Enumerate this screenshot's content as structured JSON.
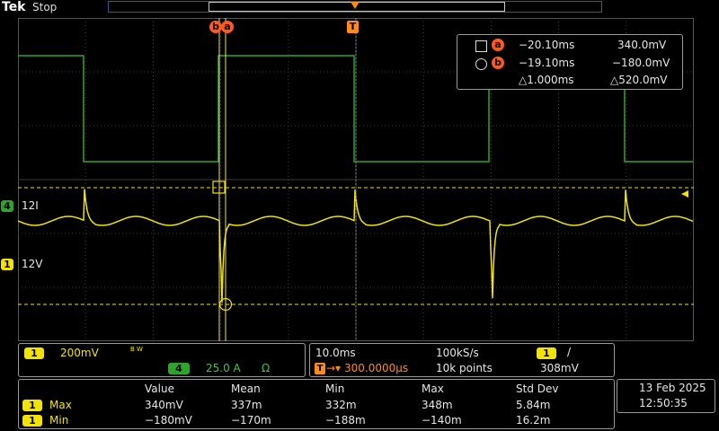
{
  "header": {
    "brand": "Tek",
    "status": "Stop"
  },
  "markers": {
    "cursor_b": "b",
    "cursor_a": "a",
    "trigger": "T"
  },
  "channels": {
    "ch4": {
      "num": "4",
      "label": "12I"
    },
    "ch1": {
      "num": "1",
      "label": "12V"
    }
  },
  "cursor_readout": {
    "a_time": "−20.10ms",
    "a_value": "340.0mV",
    "b_time": "−19.10ms",
    "b_value": "−180.0mV",
    "delta_time": "△1.000ms",
    "delta_value": "△520.0mV"
  },
  "vertical": {
    "ch1_num": "1",
    "ch1_scale": "200mV",
    "bw": "B W",
    "ch4_num": "4",
    "ch4_scale": "25.0 A",
    "ch4_unit": "Ω"
  },
  "horizontal": {
    "timebase": "10.0ms",
    "sample_rate": "100kS/s",
    "trig_source": "1",
    "trig_slope": "/",
    "trig_icon": "T",
    "trig_delay": "300.0000µs",
    "record_length": "10k points",
    "trig_level": "308mV"
  },
  "measurements": {
    "headers": [
      "Value",
      "Mean",
      "Min",
      "Max",
      "Std Dev"
    ],
    "rows": [
      {
        "ch": "1",
        "name": "Max",
        "values": [
          "340mV",
          "337m",
          "332m",
          "348m",
          "5.84m"
        ]
      },
      {
        "ch": "1",
        "name": "Min",
        "values": [
          "−180mV",
          "−170m",
          "−188m",
          "−140m",
          "16.2m"
        ]
      }
    ]
  },
  "datetime": {
    "date": "13 Feb  2025",
    "time": "12:50:35"
  },
  "colors": {
    "ch1": "#f2e400",
    "ch4": "#2da52d",
    "cursor": "#ff5a1a",
    "grid": "#3a3a3a"
  }
}
